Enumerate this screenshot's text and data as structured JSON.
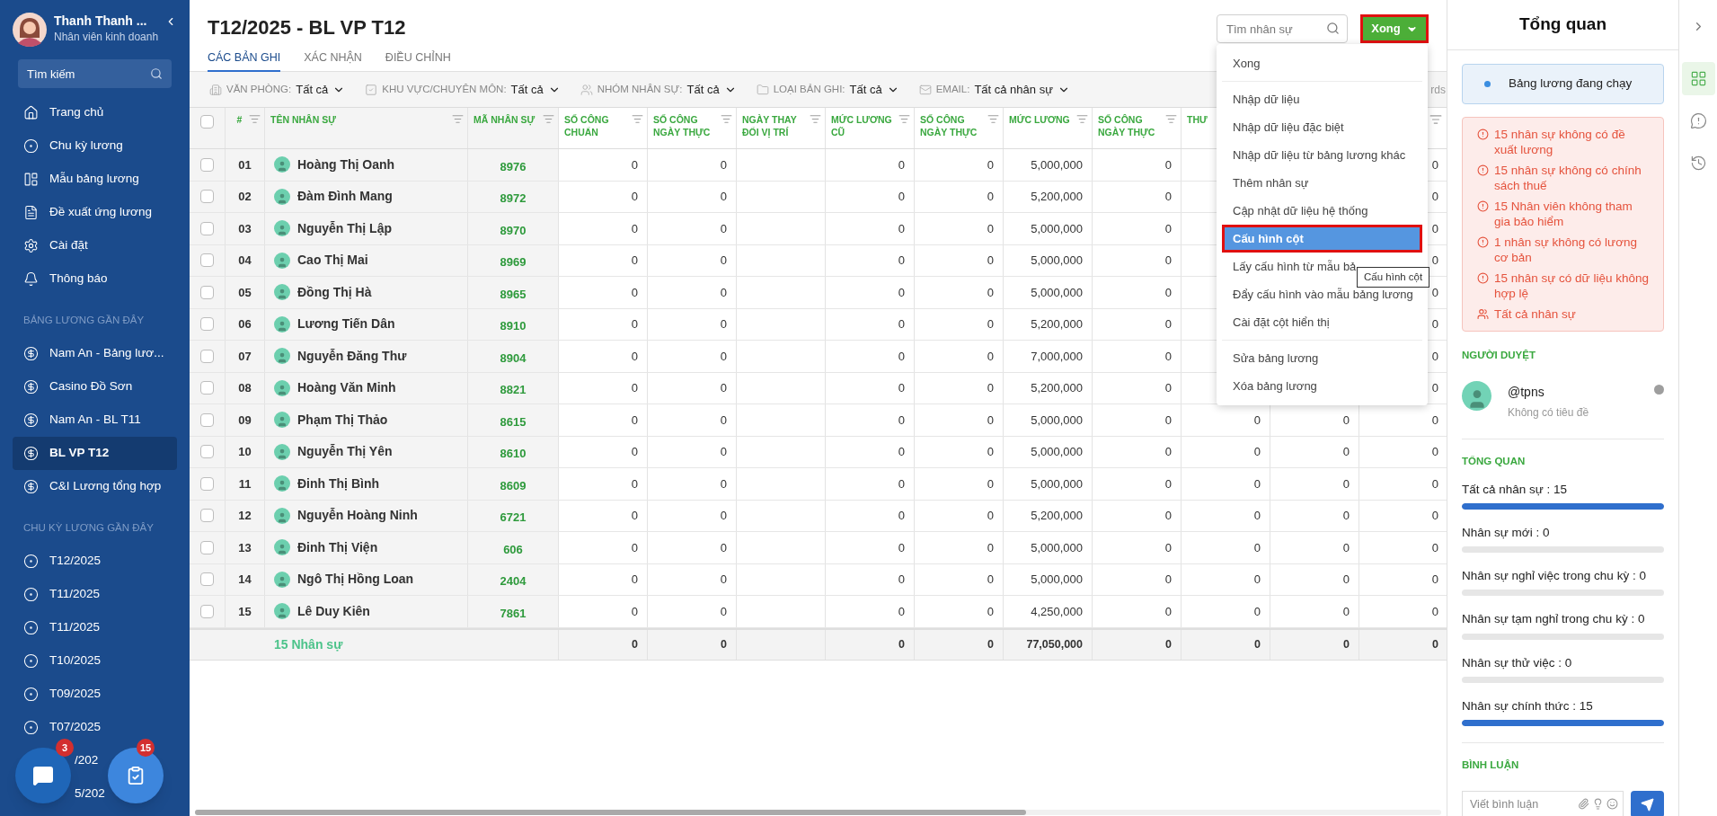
{
  "sidebar": {
    "user": {
      "name": "Thanh Thanh ...",
      "role": "Nhân viên kinh doanh"
    },
    "search": {
      "placeholder": "Tìm kiếm"
    },
    "nav": [
      {
        "label": "Trang chủ",
        "selected": false
      },
      {
        "label": "Chu kỳ lương",
        "selected": false
      },
      {
        "label": "Mẫu bảng lương",
        "selected": false
      },
      {
        "label": "Đề xuất ứng lương",
        "selected": false
      },
      {
        "label": "Cài đặt",
        "selected": false
      },
      {
        "label": "Thông báo",
        "selected": false
      }
    ],
    "sections": [
      {
        "title": "BẢNG LƯƠNG GẦN ĐÂY",
        "kind": "payroll",
        "items": [
          {
            "label": "Nam An - Bảng lươ...",
            "selected": false
          },
          {
            "label": "Casino Đồ Sơn",
            "selected": false
          },
          {
            "label": "Nam An - BL T11",
            "selected": false
          },
          {
            "label": "BL VP T12",
            "selected": true
          },
          {
            "label": "C&I Lương tổng hợp",
            "selected": false
          }
        ]
      },
      {
        "title": "CHU KỲ LƯƠNG GẦN ĐÂY",
        "kind": "cycle",
        "items": [
          {
            "label": "T12/2025",
            "selected": false
          },
          {
            "label": "T11/2025",
            "selected": false
          },
          {
            "label": "T11/2025",
            "selected": false
          },
          {
            "label": "T10/2025",
            "selected": false
          },
          {
            "label": "T09/2025",
            "selected": false
          },
          {
            "label": "T07/2025",
            "selected": false
          },
          {
            "label": "/202",
            "selected": false,
            "kind": "partial"
          },
          {
            "label": "5/202",
            "selected": false,
            "kind": "partial"
          }
        ]
      }
    ],
    "fabs": [
      {
        "kind": "chat",
        "badge": "3"
      },
      {
        "kind": "tasks",
        "badge": "15"
      }
    ]
  },
  "header": {
    "title": "T12/2025 - BL VP T12",
    "tabs": [
      {
        "label": "CÁC BẢN GHI",
        "selected": true
      },
      {
        "label": "XÁC NHẬN",
        "selected": false
      },
      {
        "label": "ĐIỀU CHỈNH",
        "selected": false
      }
    ],
    "search": {
      "placeholder": "Tìm nhân sự"
    },
    "action_button": "Xong"
  },
  "filters": [
    {
      "label": "VĂN PHÒNG:",
      "value": "Tất cả"
    },
    {
      "label": "KHU VỰC/CHUYÊN MÔN:",
      "value": "Tất cả"
    },
    {
      "label": "NHÓM NHÂN SỰ:",
      "value": "Tất cả"
    },
    {
      "label": "LOẠI BẢN GHI:",
      "value": "Tất cả"
    },
    {
      "label": "EMAIL:",
      "value": "Tất cả nhân sự"
    }
  ],
  "records_text": "rds",
  "table": {
    "header_checked": false,
    "columns": [
      "#",
      "TÊN NHÂN SỰ",
      "MÃ NHÂN SỰ",
      "SỐ CÔNG CHUẨN",
      "SỐ CÔNG NGÀY THỰC",
      "NGÀY THAY ĐỔI VỊ TRÍ",
      "MỨC LƯƠNG CŨ",
      "SỐ CÔNG NGÀY THỰC",
      "MỨC LƯƠNG",
      "SỐ CÔNG NGÀY THỰC",
      "THƯ"
    ],
    "rows": [
      {
        "checked": false,
        "index": "01",
        "name": "Hoàng Thị Oanh",
        "code": "8976",
        "standard_days": "0",
        "actual_days": "0",
        "old_salary": "0",
        "actual_days_2": "0",
        "salary": "5,000,000",
        "actual_days_3": "0",
        "column_13": "0"
      },
      {
        "checked": false,
        "index": "02",
        "name": "Đàm Đình Mang",
        "code": "8972",
        "standard_days": "0",
        "actual_days": "0",
        "old_salary": "0",
        "actual_days_2": "0",
        "salary": "5,200,000",
        "actual_days_3": "0",
        "column_13": "0"
      },
      {
        "checked": false,
        "index": "03",
        "name": "Nguyễn Thị Lập",
        "code": "8970",
        "standard_days": "0",
        "actual_days": "0",
        "old_salary": "0",
        "actual_days_2": "0",
        "salary": "5,000,000",
        "actual_days_3": "0",
        "column_13": "0"
      },
      {
        "checked": false,
        "index": "04",
        "name": "Cao Thị Mai",
        "code": "8969",
        "standard_days": "0",
        "actual_days": "0",
        "old_salary": "0",
        "actual_days_2": "0",
        "salary": "5,000,000",
        "actual_days_3": "0",
        "column_13": "0"
      },
      {
        "checked": false,
        "index": "05",
        "name": "Đồng Thị Hà",
        "code": "8965",
        "standard_days": "0",
        "actual_days": "0",
        "old_salary": "0",
        "actual_days_2": "0",
        "salary": "5,000,000",
        "actual_days_3": "0",
        "column_13": "0"
      },
      {
        "checked": false,
        "index": "06",
        "name": "Lương Tiến Dân",
        "code": "8910",
        "standard_days": "0",
        "actual_days": "0",
        "old_salary": "0",
        "actual_days_2": "0",
        "salary": "5,200,000",
        "actual_days_3": "0",
        "column_13": "0"
      },
      {
        "checked": false,
        "index": "07",
        "name": "Nguyễn Đăng Thư",
        "code": "8904",
        "standard_days": "0",
        "actual_days": "0",
        "old_salary": "0",
        "actual_days_2": "0",
        "salary": "7,000,000",
        "actual_days_3": "0",
        "column_13": "0"
      },
      {
        "checked": false,
        "index": "08",
        "name": "Hoàng Văn Minh",
        "code": "8821",
        "standard_days": "0",
        "actual_days": "0",
        "old_salary": "0",
        "actual_days_2": "0",
        "salary": "5,200,000",
        "actual_days_3": "0",
        "column_13": "0"
      },
      {
        "checked": false,
        "index": "09",
        "name": "Phạm Thị Thảo",
        "code": "8615",
        "standard_days": "0",
        "actual_days": "0",
        "old_salary": "0",
        "actual_days_2": "0",
        "salary": "5,000,000",
        "actual_days_3": "0",
        "column_11": "0",
        "column_12": "0",
        "column_13": "0"
      },
      {
        "checked": false,
        "index": "10",
        "name": "Nguyễn Thị Yên",
        "code": "8610",
        "standard_days": "0",
        "actual_days": "0",
        "old_salary": "0",
        "actual_days_2": "0",
        "salary": "5,000,000",
        "actual_days_3": "0",
        "column_11": "0",
        "column_12": "0",
        "column_13": "0"
      },
      {
        "checked": false,
        "index": "11",
        "name": "Đinh Thị Bình",
        "code": "8609",
        "standard_days": "0",
        "actual_days": "0",
        "old_salary": "0",
        "actual_days_2": "0",
        "salary": "5,000,000",
        "actual_days_3": "0",
        "column_11": "0",
        "column_12": "0",
        "column_13": "0"
      },
      {
        "checked": false,
        "index": "12",
        "name": "Nguyễn Hoàng Ninh",
        "code": "6721",
        "standard_days": "0",
        "actual_days": "0",
        "old_salary": "0",
        "actual_days_2": "0",
        "salary": "5,200,000",
        "actual_days_3": "0",
        "column_11": "0",
        "column_12": "0",
        "column_13": "0"
      },
      {
        "checked": false,
        "index": "13",
        "name": "Đinh Thị Viện",
        "code": "606",
        "standard_days": "0",
        "actual_days": "0",
        "old_salary": "0",
        "actual_days_2": "0",
        "salary": "5,000,000",
        "actual_days_3": "0",
        "column_11": "0",
        "column_12": "0",
        "column_13": "0"
      },
      {
        "checked": false,
        "index": "14",
        "name": "Ngô Thị Hồng Loan",
        "code": "2404",
        "standard_days": "0",
        "actual_days": "0",
        "old_salary": "0",
        "actual_days_2": "0",
        "salary": "5,000,000",
        "actual_days_3": "0",
        "column_11": "0",
        "column_12": "0",
        "column_13": "0"
      },
      {
        "checked": false,
        "index": "15",
        "name": "Lê Duy Kiên",
        "code": "7861",
        "standard_days": "0",
        "actual_days": "0",
        "old_salary": "0",
        "actual_days_2": "0",
        "salary": "4,250,000",
        "actual_days_3": "0",
        "column_11": "0",
        "column_12": "0",
        "column_13": "0"
      }
    ],
    "footer": {
      "label": "15 Nhân sự",
      "standard_days": "0",
      "actual_days": "0",
      "old_salary": "0",
      "actual_days_2": "0",
      "salary": "77,050,000",
      "actual_days_3": "0",
      "column_11": "0",
      "column_12": "0",
      "column_13": "0"
    }
  },
  "menu": {
    "groups": [
      [
        {
          "label": "Xong",
          "selected": false
        }
      ],
      [
        {
          "label": "Nhập dữ liệu",
          "selected": false
        },
        {
          "label": "Nhập dữ liệu đặc biệt",
          "selected": false
        },
        {
          "label": "Nhập dữ liệu từ bảng lương khác",
          "selected": false
        },
        {
          "label": "Thêm nhân sự",
          "selected": false
        },
        {
          "label": "Cập nhật dữ liệu hệ thống",
          "selected": false
        },
        {
          "label": "Cấu hình cột",
          "selected": true
        },
        {
          "label": "Lấy cấu hình từ mẫu bả",
          "selected": false
        },
        {
          "label": "Đẩy cấu hình vào mẫu bảng lương",
          "selected": false
        },
        {
          "label": "Cài đặt cột hiển thị",
          "selected": false
        }
      ],
      [
        {
          "label": "Sửa bảng lương",
          "selected": false
        },
        {
          "label": "Xóa bảng lương",
          "selected": false
        }
      ]
    ],
    "tooltip": "Cấu hình cột"
  },
  "overview": {
    "title": "Tổng quan",
    "status": "Bảng lương đang chạy",
    "warnings": [
      {
        "kind": "alert",
        "text": "15 nhân sự không có đề xuất lương"
      },
      {
        "kind": "alert",
        "text": "15 nhân sự không có chính sách thuế"
      },
      {
        "kind": "alert",
        "text": "15 Nhân viên không tham gia bảo hiểm"
      },
      {
        "kind": "alert",
        "text": "1 nhân sự không có lương cơ bản"
      },
      {
        "kind": "alert",
        "text": "15 nhân sự có dữ liệu không hợp lệ"
      },
      {
        "kind": "people",
        "text": "Tất cả nhân sự"
      }
    ],
    "approver_heading": "NGƯỜI DUYỆT",
    "approver": {
      "handle": "@tpns",
      "subtitle": "Không có tiêu đề",
      "color": "#9e9e9e"
    },
    "stats_heading": "TỔNG QUAN",
    "stats": [
      {
        "label": "Tất cả nhân sự : 15",
        "level": 1
      },
      {
        "label": "Nhân sự mới : 0",
        "level": 0
      },
      {
        "label": "Nhân sự nghỉ việc trong chu kỳ : 0",
        "level": 0
      },
      {
        "label": "Nhân sự tạm nghỉ trong chu kỳ : 0",
        "level": 0
      },
      {
        "label": "Nhân sự thử việc : 0",
        "level": 0
      },
      {
        "label": "Nhân sự chính thức : 15",
        "level": 1
      }
    ],
    "comments_heading": "BÌNH LUẬN",
    "comment_placeholder": "Viết bình luận"
  },
  "rail": [
    {
      "kind": "grid",
      "selected": true
    },
    {
      "kind": "info",
      "selected": false
    },
    {
      "kind": "history",
      "selected": false
    }
  ]
}
